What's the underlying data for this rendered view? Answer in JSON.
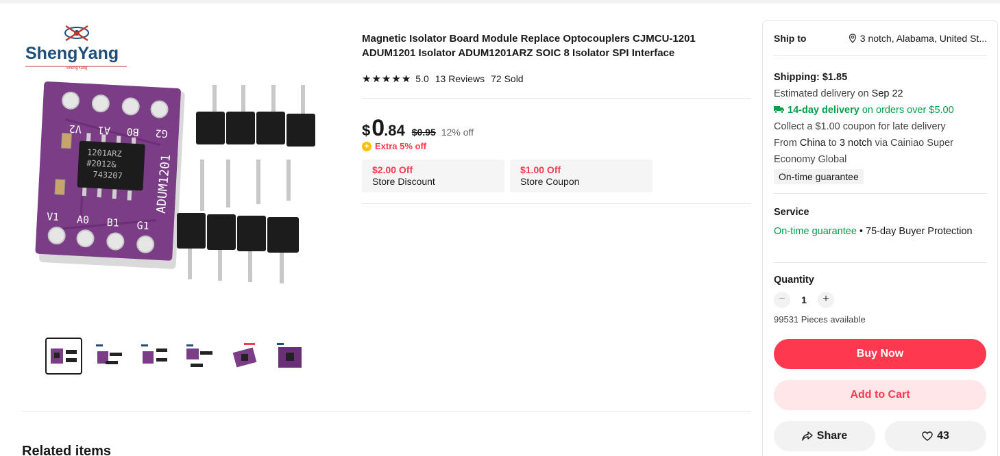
{
  "brand": {
    "name": "ShengYang",
    "subname": "ShengYang"
  },
  "board": {
    "top_pins": [
      "V2",
      "A1",
      "B0",
      "G2"
    ],
    "bottom_pins": [
      "V1",
      "A0",
      "B1",
      "G1"
    ],
    "chip_lines": [
      "1201ARZ",
      "#2012&",
      "743207"
    ],
    "side_label": "ADUM1201"
  },
  "product": {
    "title": "Magnetic Isolator Board Module Replace Optocouplers CJMCU-1201 ADUM1201 Isolator ADUM1201ARZ SOIC 8 Isolator SPI Interface",
    "rating": {
      "stars": 5,
      "score": "5.0",
      "reviews": "13 Reviews",
      "sold": "72 Sold"
    },
    "price": {
      "currency": "$",
      "integer": "0",
      "decimal": ".84",
      "original": "$0.95",
      "discount": "12% off"
    },
    "extra_discount": "Extra 5% off",
    "coupons": [
      {
        "amount": "$2.00 Off",
        "label": "Store Discount"
      },
      {
        "amount": "$1.00 Off",
        "label": "Store Coupon"
      }
    ]
  },
  "panel": {
    "ship_to_label": "Ship to",
    "ship_to_location": "3 notch, Alabama, United St...",
    "shipping_title": "Shipping: $1.85",
    "delivery_prefix": "Estimated delivery on ",
    "delivery_date": "Sep 22",
    "free_delivery_bold": "14-day delivery",
    "free_delivery_rest": " on orders over $5.00",
    "coupon_note": "Collect a $1.00 coupon for late delivery",
    "route_from": "From ",
    "route_origin": "China",
    "route_to": " to ",
    "route_dest": "3 notch",
    "route_via": " via Cainiao Super Economy Global",
    "guarantee_badge": "On-time guarantee",
    "service_title": "Service",
    "service_guarantee": "On-time guarantee",
    "service_rest": " • 75-day Buyer Protection",
    "quantity_title": "Quantity",
    "quantity_value": "1",
    "minus": "−",
    "plus": "+",
    "available": "99531 Pieces available",
    "buy_now": "Buy Now",
    "add_to_cart": "Add to Cart",
    "share": "Share",
    "wishlist_count": "43"
  },
  "related_title": "Related items",
  "colors": {
    "accent": "#fd384f",
    "green": "#00a048",
    "pcb": "#7a3d86",
    "brand_blue": "#1f4e79",
    "brand_red": "#c0392b"
  }
}
